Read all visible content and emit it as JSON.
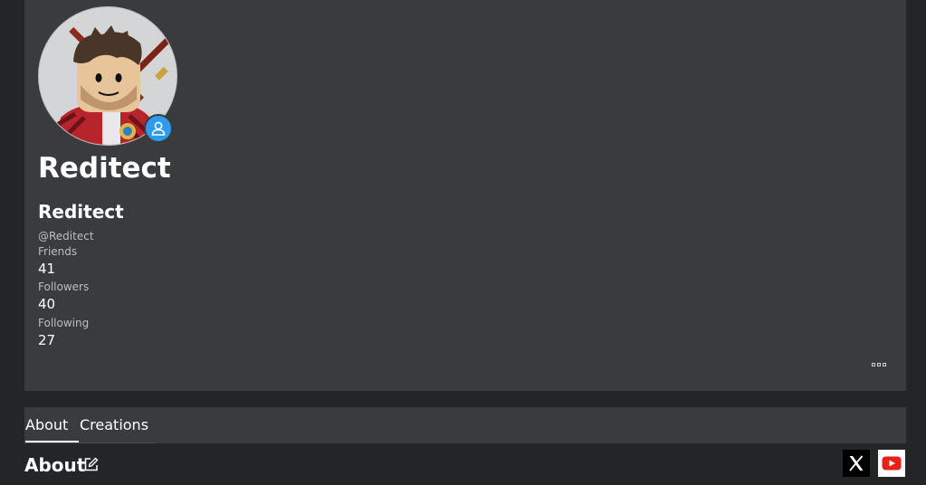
{
  "profile": {
    "display_name": "Reditect",
    "username": "Reditect",
    "handle": "@Reditect",
    "avatar_icon": "avatar-headshot",
    "presence_icon": "user-icon",
    "presence_color": "#2d9bf0",
    "stats": [
      {
        "label": "Friends",
        "value": "41"
      },
      {
        "label": "Followers",
        "value": "40"
      },
      {
        "label": "Following",
        "value": "27"
      }
    ],
    "more_icon": "more-options-icon"
  },
  "tabs": [
    {
      "label": "About",
      "active": true
    },
    {
      "label": "Creations",
      "active": false
    }
  ],
  "about": {
    "heading": "About",
    "edit_icon": "edit-icon"
  },
  "social": [
    {
      "name": "x-icon"
    },
    {
      "name": "youtube-icon",
      "color": "#e62117"
    }
  ],
  "colors": {
    "page_bg": "#232527",
    "card_bg": "#393b3d",
    "accent": "#2d9bf0"
  }
}
